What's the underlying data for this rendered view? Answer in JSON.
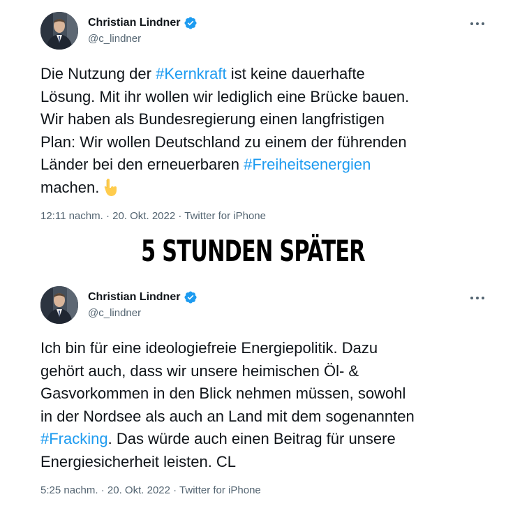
{
  "colors": {
    "hashtag": "#1d9bf0",
    "verified_badge": "#1d9bf0",
    "secondary_text": "#536471",
    "primary_text": "#0f1419"
  },
  "tweets": [
    {
      "author_name": "Christian Lindner",
      "handle": "@c_lindner",
      "verified": true,
      "avatar_icon": "profile-photo",
      "more_icon": "more-horizontal-icon",
      "lines": [
        [
          {
            "t": "Die Nutzung der "
          },
          {
            "t": "#Kernkraft",
            "h": true
          },
          {
            "t": " ist keine dauerhafte"
          }
        ],
        [
          {
            "t": "Lösung. Mit ihr wollen wir lediglich eine Brücke bauen."
          }
        ],
        [
          {
            "t": "Wir haben als Bundesregierung einen langfristigen"
          }
        ],
        [
          {
            "t": "Plan: Wir wollen Deutschland zu einem der führenden"
          }
        ],
        [
          {
            "t": "Länder bei den erneuerbaren "
          },
          {
            "t": "#Freiheitsenergien",
            "h": true
          }
        ],
        [
          {
            "t": "machen."
          },
          {
            "emoji": "pointing-down-hand-emoji"
          }
        ]
      ],
      "time": "12:11 nachm.",
      "date": "20. Okt. 2022",
      "source": "Twitter for iPhone"
    },
    {
      "author_name": "Christian Lindner",
      "handle": "@c_lindner",
      "verified": true,
      "avatar_icon": "profile-photo",
      "more_icon": "more-horizontal-icon",
      "lines": [
        [
          {
            "t": "Ich bin für eine ideologiefreie Energiepolitik. Dazu"
          }
        ],
        [
          {
            "t": "gehört auch, dass wir unsere heimischen Öl- &"
          }
        ],
        [
          {
            "t": "Gasvorkommen in den Blick nehmen müssen, sowohl"
          }
        ],
        [
          {
            "t": "in der Nordsee als auch an Land mit dem sogenannten"
          }
        ],
        [
          {
            "t": "#Fracking",
            "h": true
          },
          {
            "t": ". Das würde auch einen Beitrag für unsere"
          }
        ],
        [
          {
            "t": "Energiesicherheit leisten. CL"
          }
        ]
      ],
      "time": "5:25 nachm.",
      "date": "20. Okt. 2022",
      "source": "Twitter for iPhone"
    }
  ],
  "banner": {
    "text": "5 STUNDEN SPÄTER"
  }
}
